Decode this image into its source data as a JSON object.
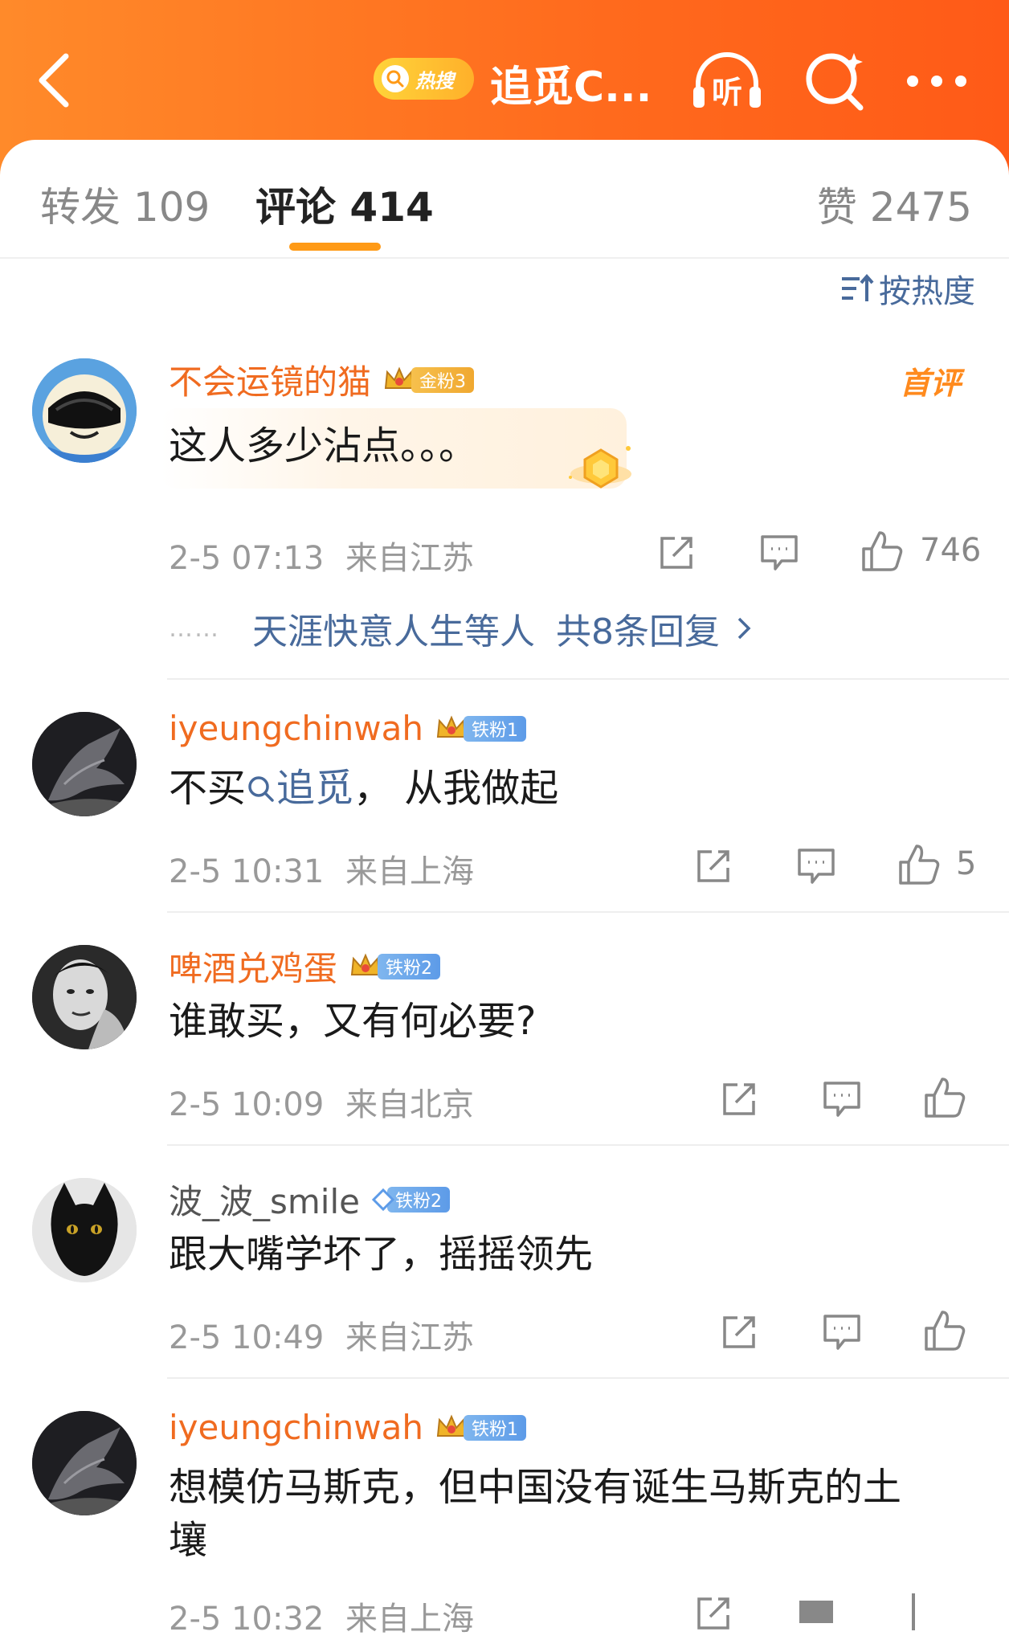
{
  "colors": {
    "brand_orange": "#ff6a1d",
    "username_orange": "#f06b20",
    "link_blue": "#486a9b",
    "tab_underline": "#ff9a16"
  },
  "header": {
    "hot_label": "热搜",
    "topic_title": "追觅C...",
    "icons": [
      "back-icon",
      "listen-icon",
      "search-icon",
      "more-icon"
    ],
    "listen_label": "听"
  },
  "tabs": [
    {
      "label": "转发 109"
    },
    {
      "label": "评论 414"
    },
    {
      "label": "赞 2475"
    }
  ],
  "sort": {
    "label": "按热度"
  },
  "comments": [
    {
      "username": "不会运镜的猫",
      "badge": "金粉3",
      "tag": "首评",
      "text": "这人多少沾点。。。",
      "time": "2-5 07:13",
      "location": "来自江苏",
      "likes": "746",
      "replies_people": "天涯快意人生等人",
      "replies_count": "共8条回复",
      "reply_prefix": "……"
    },
    {
      "username": "iyeungchinwah",
      "badge": "铁粉1",
      "text_before": "不买",
      "text_link": "追觅",
      "text_after": "， 从我做起",
      "time": "2-5 10:31",
      "location": "来自上海",
      "likes": "5"
    },
    {
      "username": "啤酒兑鸡蛋",
      "badge": "铁粉2",
      "text": "谁敢买，又有何必要?",
      "time": "2-5 10:09",
      "location": "来自北京",
      "likes": ""
    },
    {
      "username": "波_波_smile",
      "badge": "铁粉2",
      "text": "跟大嘴学坏了，摇摇领先",
      "time": "2-5 10:49",
      "location": "来自江苏",
      "likes": ""
    },
    {
      "username": "iyeungchinwah",
      "badge": "铁粉1",
      "text_line1": "想模仿马斯克，但中国没有诞生马斯克的土",
      "text_line2": "壤",
      "time": "2-5 10:32",
      "location": "来自上海",
      "likes": ""
    }
  ]
}
